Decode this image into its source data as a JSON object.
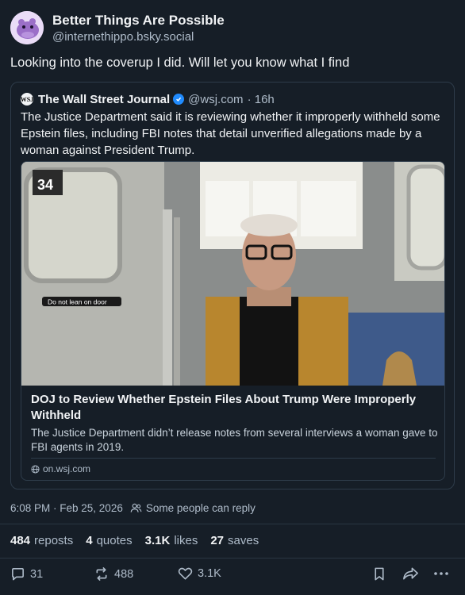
{
  "author": {
    "display_name": "Better Things Are Possible",
    "handle": "@internethippo.bsky.social",
    "avatar_icon": "hippo-avatar"
  },
  "post": {
    "text": "Looking into the coverup I did. Will let you know what I find"
  },
  "quote": {
    "avatar_text": "WSJ",
    "name": "The Wall Street Journal",
    "verified": true,
    "handle": "@wsj.com",
    "time": "· 16h",
    "text": "The Justice Department said it is reviewing whether it improperly withheld some Epstein files, including FBI notes that detail unverified allegations made by a woman against President Trump.",
    "embed": {
      "image_sign_text": "Do not lean on door",
      "image_car_number": "34",
      "title": "DOJ to Review Whether Epstein Files About Trump Were Improperly Withheld",
      "description": "The Justice Department didn’t release notes from several interviews a woman gave to FBI agents in 2019.",
      "domain": "on.wsj.com"
    }
  },
  "meta": {
    "timestamp": "6:08 PM · Feb 25, 2026",
    "reply_setting": "Some people can reply"
  },
  "stats": {
    "reposts_count": "484",
    "reposts_label": "reposts",
    "quotes_count": "4",
    "quotes_label": "quotes",
    "likes_count": "3.1K",
    "likes_label": "likes",
    "saves_count": "27",
    "saves_label": "saves"
  },
  "actions": {
    "reply_count": "31",
    "repost_count": "488",
    "like_count": "3.1K"
  },
  "colors": {
    "background": "#161e27",
    "border": "#2e3c4a",
    "text_primary": "#f1f3f5",
    "text_secondary": "#aebbc9",
    "verified_blue": "#208bfe"
  }
}
